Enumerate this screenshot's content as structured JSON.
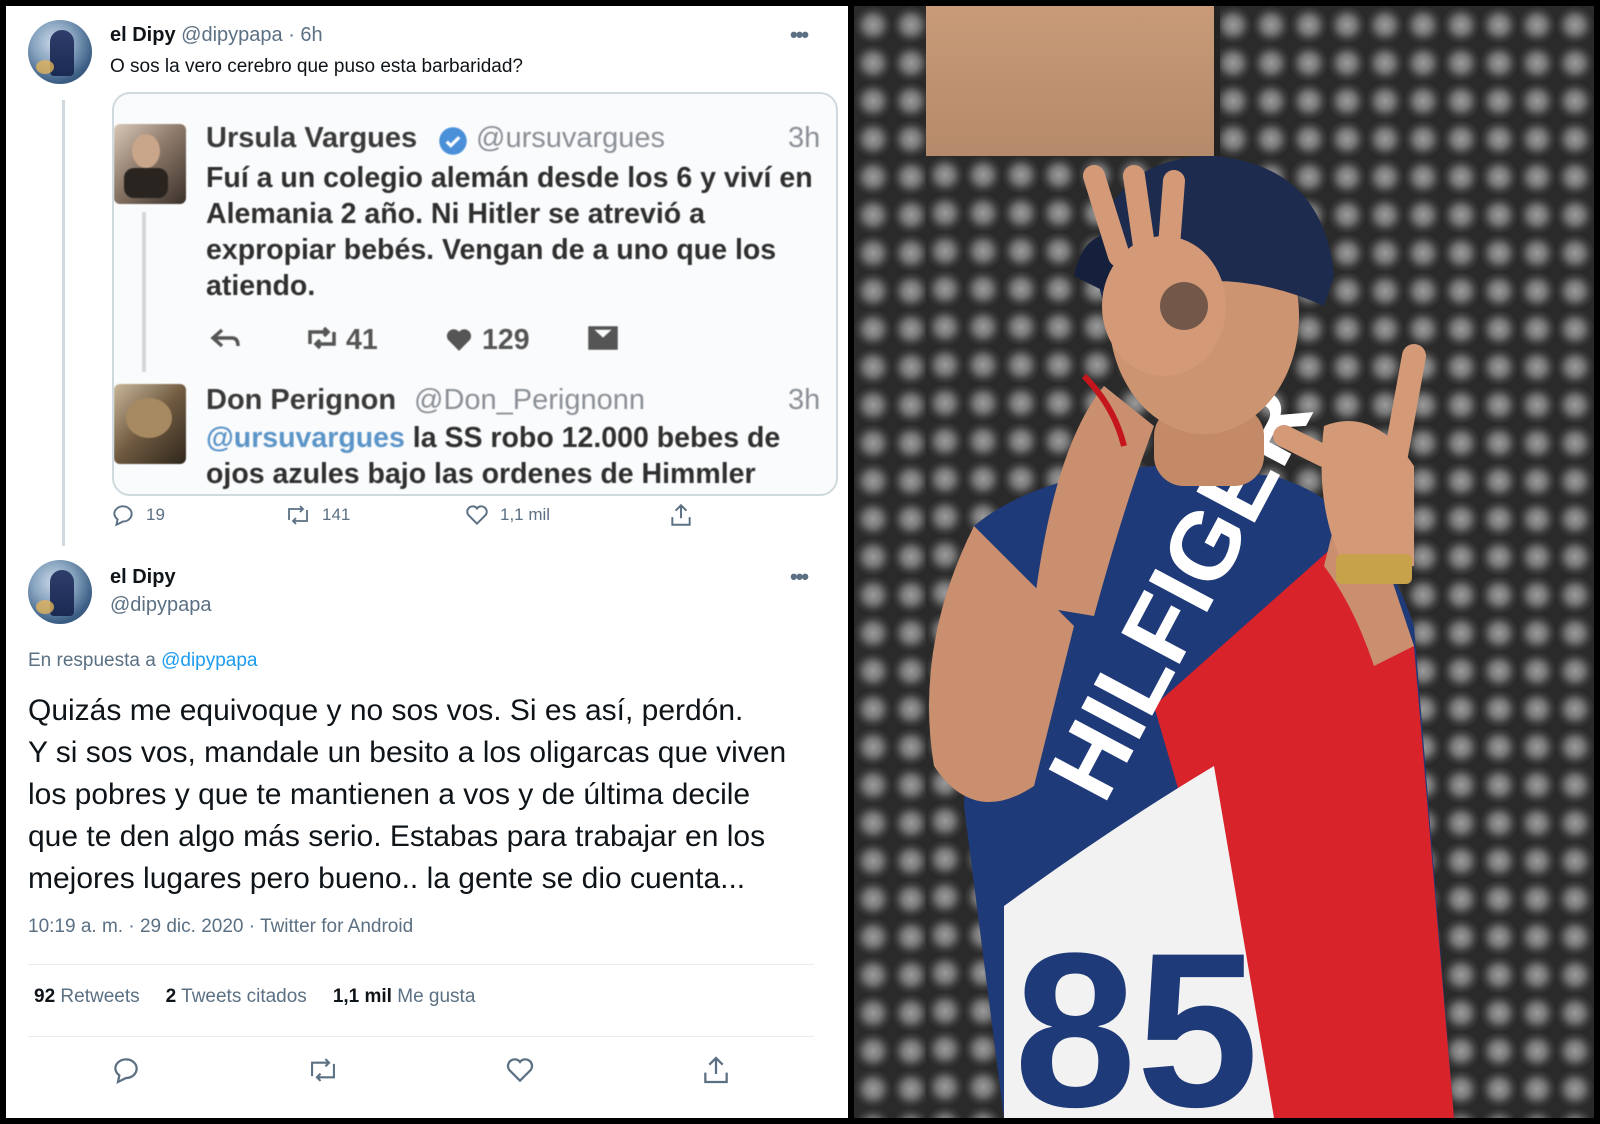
{
  "tweet1": {
    "name": "el Dipy",
    "handle": "@dipypapa",
    "time": "· 6h",
    "text": "O sos la vero cerebro que puso esta barbaridad?",
    "actions": {
      "reply": "19",
      "retweet": "141",
      "like": "1,1 mil"
    }
  },
  "embedded": {
    "tweet_a": {
      "name": "Ursula Vargues",
      "handle": "@ursuvargues",
      "time": "3h",
      "lines": [
        "Fuí a un colegio alemán desde los 6 y viví en",
        "Alemania 2 año. Ni Hitler se atrevió a",
        "expropiar bebés. Vengan de a uno que los",
        "atiendo."
      ],
      "retweets": "41",
      "likes": "129"
    },
    "tweet_b": {
      "name": "Don Perignon",
      "handle": "@Don_Perignonn",
      "time": "3h",
      "mention": "@ursuvargues",
      "line1_rest": " la SS robo 12.000 bebes de",
      "line2": "ojos azules bajo las ordenes de Himmler"
    }
  },
  "tweet2": {
    "name": "el Dipy",
    "handle": "@dipypapa",
    "reply_prefix": "En respuesta a",
    "reply_to": "@dipypapa",
    "text_lines": [
      "Quizás me equivoque y no sos vos. Si es así, perdón.",
      "Y si sos vos, mandale un besito a los oligarcas que viven",
      "los pobres y que te mantienen a vos y de última decile",
      "que te den algo más serio. Estabas para trabajar en los",
      "mejores lugares pero bueno.. la gente se dio cuenta..."
    ],
    "timestamp": "10:19 a. m. · 29 dic. 2020 · Twitter for Android",
    "stats": {
      "retweets_count": "92",
      "retweets_label": "Retweets",
      "quotes_count": "2",
      "quotes_label": "Tweets citados",
      "likes_count": "1,1 mil",
      "likes_label": "Me gusta"
    }
  },
  "photo": {
    "shirt_text": "HILFIGER",
    "shirt_number": "85"
  },
  "icons": [
    "reply-icon",
    "retweet-icon",
    "like-icon",
    "share-icon",
    "more-icon",
    "dm-icon",
    "verified-icon"
  ],
  "colors": {
    "accent": "#1d9bf0",
    "muted": "#5b7083",
    "text": "#0f1419"
  }
}
